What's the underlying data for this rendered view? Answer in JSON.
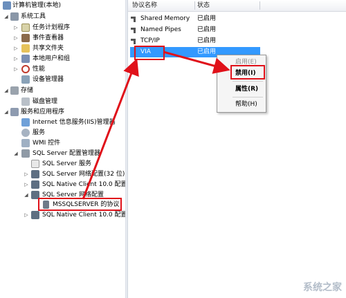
{
  "tree": {
    "root": "计算机管理(本地)",
    "system_tools": "系统工具",
    "task_scheduler": "任务计划程序",
    "event_viewer": "事件查看器",
    "shared_folders": "共享文件夹",
    "local_users": "本地用户和组",
    "performance": "性能",
    "device_manager": "设备管理器",
    "storage": "存储",
    "disk_management": "磁盘管理",
    "services_apps": "服务和应用程序",
    "iis": "Internet 信息服务(IIS)管理器",
    "services": "服务",
    "wmi": "WMI 控件",
    "sql_config": "SQL Server 配置管理器",
    "sql_services": "SQL Server 服务",
    "sql_net32": "SQL Server 网络配置(32 位)",
    "native_client_a": "SQL Native Client 10.0 配置(",
    "sql_net": "SQL Server 网络配置",
    "mssql_protocols": "MSSQLSERVER 的协议",
    "native_client_b": "SQL Native Client 10.0 配置"
  },
  "list": {
    "col_name": "协议名称",
    "col_status": "状态",
    "rows": [
      {
        "name": "Shared Memory",
        "status": "已启用"
      },
      {
        "name": "Named Pipes",
        "status": "已启用"
      },
      {
        "name": "TCP/IP",
        "status": "已启用"
      },
      {
        "name": "VIA",
        "status": "已启用"
      }
    ]
  },
  "menu": {
    "enable": "启用(E)",
    "disable": "禁用(I)",
    "properties": "属性(R)",
    "help": "帮助(H)"
  },
  "watermark": "系统之家",
  "colors": {
    "selection": "#3399ff",
    "annotation": "#e0111a"
  },
  "icons": {
    "protocol": "protocol-icon",
    "folder": "folder-icon",
    "computer": "computer-icon"
  }
}
